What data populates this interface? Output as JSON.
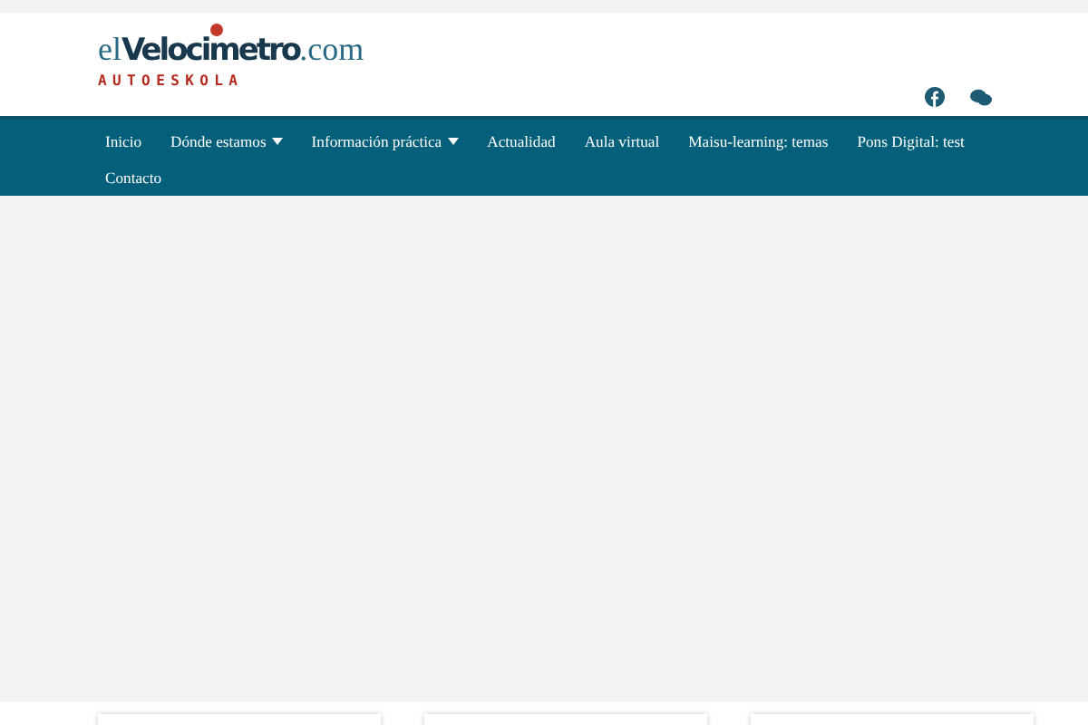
{
  "logo": {
    "prefix": "el",
    "name": "Velocimetro",
    "suffix": ".com",
    "subtitle": "AUTOESKOLA"
  },
  "nav": [
    {
      "label": "Inicio",
      "dropdown": false
    },
    {
      "label": "Dónde estamos",
      "dropdown": true
    },
    {
      "label": "Información práctica",
      "dropdown": true
    },
    {
      "label": "Actualidad",
      "dropdown": false
    },
    {
      "label": "Aula virtual",
      "dropdown": false
    },
    {
      "label": "Maisu-learning: temas",
      "dropdown": false
    },
    {
      "label": "Pons Digital: test",
      "dropdown": false
    },
    {
      "label": "Contacto",
      "dropdown": false
    }
  ]
}
